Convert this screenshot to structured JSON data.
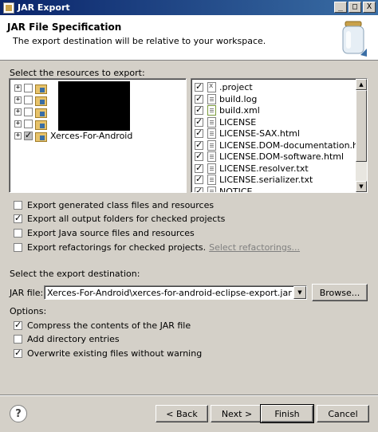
{
  "window": {
    "title": "JAR Export",
    "min_label": "_",
    "max_label": "□",
    "close_label": "X"
  },
  "header": {
    "title": "JAR File Specification",
    "description": "The export destination will be relative to your workspace."
  },
  "resources": {
    "label": "Select the resources to export:",
    "tree": [
      {
        "label": "",
        "checked": false,
        "expander": "+"
      },
      {
        "label": "",
        "checked": false,
        "expander": "+"
      },
      {
        "label": "",
        "checked": false,
        "expander": "+"
      },
      {
        "label": "",
        "checked": false,
        "expander": "+"
      },
      {
        "label": "Xerces-For-Android",
        "checked": true,
        "grayed": true,
        "expander": "+"
      }
    ],
    "files": [
      {
        "label": ".project",
        "checked": true,
        "icon": "x-file-icon"
      },
      {
        "label": "build.log",
        "checked": true,
        "icon": "text-file-icon"
      },
      {
        "label": "build.xml",
        "checked": true,
        "icon": "xml-file-icon"
      },
      {
        "label": "LICENSE",
        "checked": true,
        "icon": "text-file-icon"
      },
      {
        "label": "LICENSE-SAX.html",
        "checked": true,
        "icon": "html-file-icon"
      },
      {
        "label": "LICENSE.DOM-documentation.html",
        "checked": true,
        "icon": "html-file-icon"
      },
      {
        "label": "LICENSE.DOM-software.html",
        "checked": true,
        "icon": "html-file-icon"
      },
      {
        "label": "LICENSE.resolver.txt",
        "checked": true,
        "icon": "text-file-icon"
      },
      {
        "label": "LICENSE.serializer.txt",
        "checked": true,
        "icon": "text-file-icon"
      },
      {
        "label": "NOTICE",
        "checked": true,
        "icon": "text-file-icon"
      }
    ]
  },
  "export_options": {
    "generated_class": {
      "label": "Export generated class files and resources",
      "checked": false
    },
    "output_folders": {
      "label": "Export all output folders for checked projects",
      "checked": true
    },
    "java_source": {
      "label": "Export Java source files and resources",
      "checked": false
    },
    "refactorings": {
      "label": "Export refactorings for checked projects.",
      "checked": false,
      "link": "Select refactorings..."
    }
  },
  "destination": {
    "label": "Select the export destination:",
    "jar_file_label": "JAR file:",
    "jar_file_value": "Xerces-For-Android\\xerces-for-android-eclipse-export.jar",
    "browse_label": "Browse..."
  },
  "options": {
    "label": "Options:",
    "compress": {
      "label": "Compress the contents of the JAR file",
      "checked": true
    },
    "directory_entries": {
      "label": "Add directory entries",
      "checked": false
    },
    "overwrite": {
      "label": "Overwrite existing files without warning",
      "checked": true
    }
  },
  "footer": {
    "help_label": "?",
    "back_label": "< Back",
    "next_label": "Next >",
    "finish_label": "Finish",
    "cancel_label": "Cancel"
  },
  "colors": {
    "title_bar": "#0a246a",
    "dialog_bg": "#d4d0c8",
    "link_disabled": "#808080"
  }
}
